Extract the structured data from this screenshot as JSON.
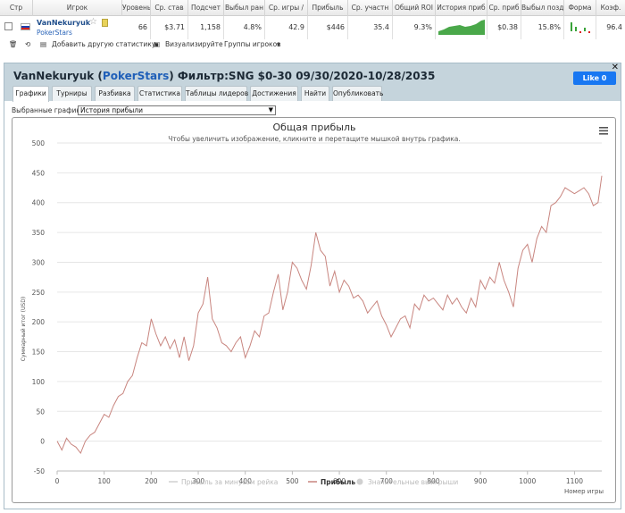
{
  "table": {
    "headers": [
      "Стр",
      "Игрок",
      "Уровень",
      "Ср. став",
      "Подсчет",
      "Выбыл ран",
      "Ср. игры /",
      "Прибыль",
      "Ср. участн",
      "Общий ROI",
      "История приб",
      "Ср. приб",
      "Выбыл позд",
      "Форма",
      "Коэф."
    ],
    "row": {
      "player_name": "VanNekuryuk",
      "site": "PokerStars",
      "level": "66",
      "avg_stake": "$3.71",
      "count": "1,158",
      "early_out": "4.8%",
      "avg_game": "42.9",
      "profit": "$446",
      "avg_entrants": "35.4",
      "total_roi": "9.3%",
      "avg_profit": "$0.38",
      "late_out": "15.8%",
      "coef": "96.4"
    }
  },
  "toolbar": {
    "add_stat": "Добавить другую статистику",
    "visualize": "Визуализируйте",
    "groups": "Группы игроков"
  },
  "panel": {
    "title_player": "VanNekuryuk",
    "title_site": "PokerStars",
    "title_filter": "Фильтр:SNG $0-30 09/30/2020-10/28/2035",
    "like_label": "Like 0",
    "tabs": [
      "Графики",
      "Турниры",
      "Разбивка",
      "Статистика",
      "Таблицы лидеров",
      "Достижения",
      "Найти",
      "Опубликовать"
    ],
    "selected_label": "Выбранные графики:",
    "selected_value": "История прибыли"
  },
  "chart_data": {
    "type": "line",
    "title": "Общая прибыль",
    "subtitle": "Чтобы увеличить изображение, кликните и перетащите мышкой внутрь графика.",
    "xlabel": "Номер игры",
    "ylabel": "Суммарный итог (USD)",
    "xlim": [
      0,
      1158
    ],
    "ylim": [
      -50,
      500
    ],
    "x_ticks": [
      0,
      100,
      200,
      300,
      400,
      500,
      600,
      700,
      800,
      900,
      1000,
      1100
    ],
    "y_ticks": [
      -50,
      0,
      50,
      100,
      150,
      200,
      250,
      300,
      350,
      400,
      450,
      500
    ],
    "legend": [
      "Прибыль за минусом рейка",
      "Прибыль",
      "Значительные выигрыши"
    ],
    "series": [
      {
        "name": "Прибыль",
        "color": "#c8857f",
        "x": [
          0,
          10,
          20,
          30,
          40,
          50,
          60,
          70,
          80,
          90,
          100,
          110,
          120,
          130,
          140,
          150,
          160,
          170,
          180,
          190,
          200,
          210,
          220,
          230,
          240,
          250,
          260,
          270,
          280,
          290,
          300,
          310,
          320,
          330,
          340,
          350,
          360,
          370,
          380,
          390,
          400,
          410,
          420,
          430,
          440,
          450,
          460,
          470,
          480,
          490,
          500,
          510,
          520,
          530,
          540,
          550,
          560,
          570,
          580,
          590,
          600,
          610,
          620,
          630,
          640,
          650,
          660,
          670,
          680,
          690,
          700,
          710,
          720,
          730,
          740,
          750,
          760,
          770,
          780,
          790,
          800,
          810,
          820,
          830,
          840,
          850,
          860,
          870,
          880,
          890,
          900,
          910,
          920,
          930,
          940,
          950,
          960,
          970,
          980,
          990,
          1000,
          1010,
          1020,
          1030,
          1040,
          1050,
          1060,
          1070,
          1080,
          1090,
          1100,
          1110,
          1120,
          1130,
          1140,
          1150,
          1158
        ],
        "y": [
          0,
          -15,
          5,
          -5,
          -10,
          -20,
          0,
          10,
          15,
          30,
          45,
          40,
          60,
          75,
          80,
          100,
          110,
          140,
          165,
          160,
          205,
          180,
          160,
          175,
          155,
          170,
          140,
          175,
          135,
          160,
          215,
          230,
          275,
          205,
          190,
          165,
          160,
          150,
          165,
          175,
          140,
          160,
          185,
          175,
          210,
          215,
          250,
          280,
          220,
          250,
          300,
          290,
          270,
          255,
          295,
          350,
          320,
          310,
          260,
          285,
          250,
          270,
          260,
          240,
          245,
          235,
          215,
          225,
          235,
          210,
          195,
          175,
          190,
          205,
          210,
          190,
          230,
          220,
          245,
          235,
          240,
          230,
          220,
          245,
          230,
          240,
          225,
          215,
          240,
          225,
          270,
          255,
          275,
          265,
          300,
          270,
          250,
          225,
          290,
          320,
          330,
          300,
          340,
          360,
          350,
          395,
          400,
          410,
          425,
          420,
          415,
          420,
          425,
          415,
          395,
          400,
          445
        ]
      }
    ]
  }
}
